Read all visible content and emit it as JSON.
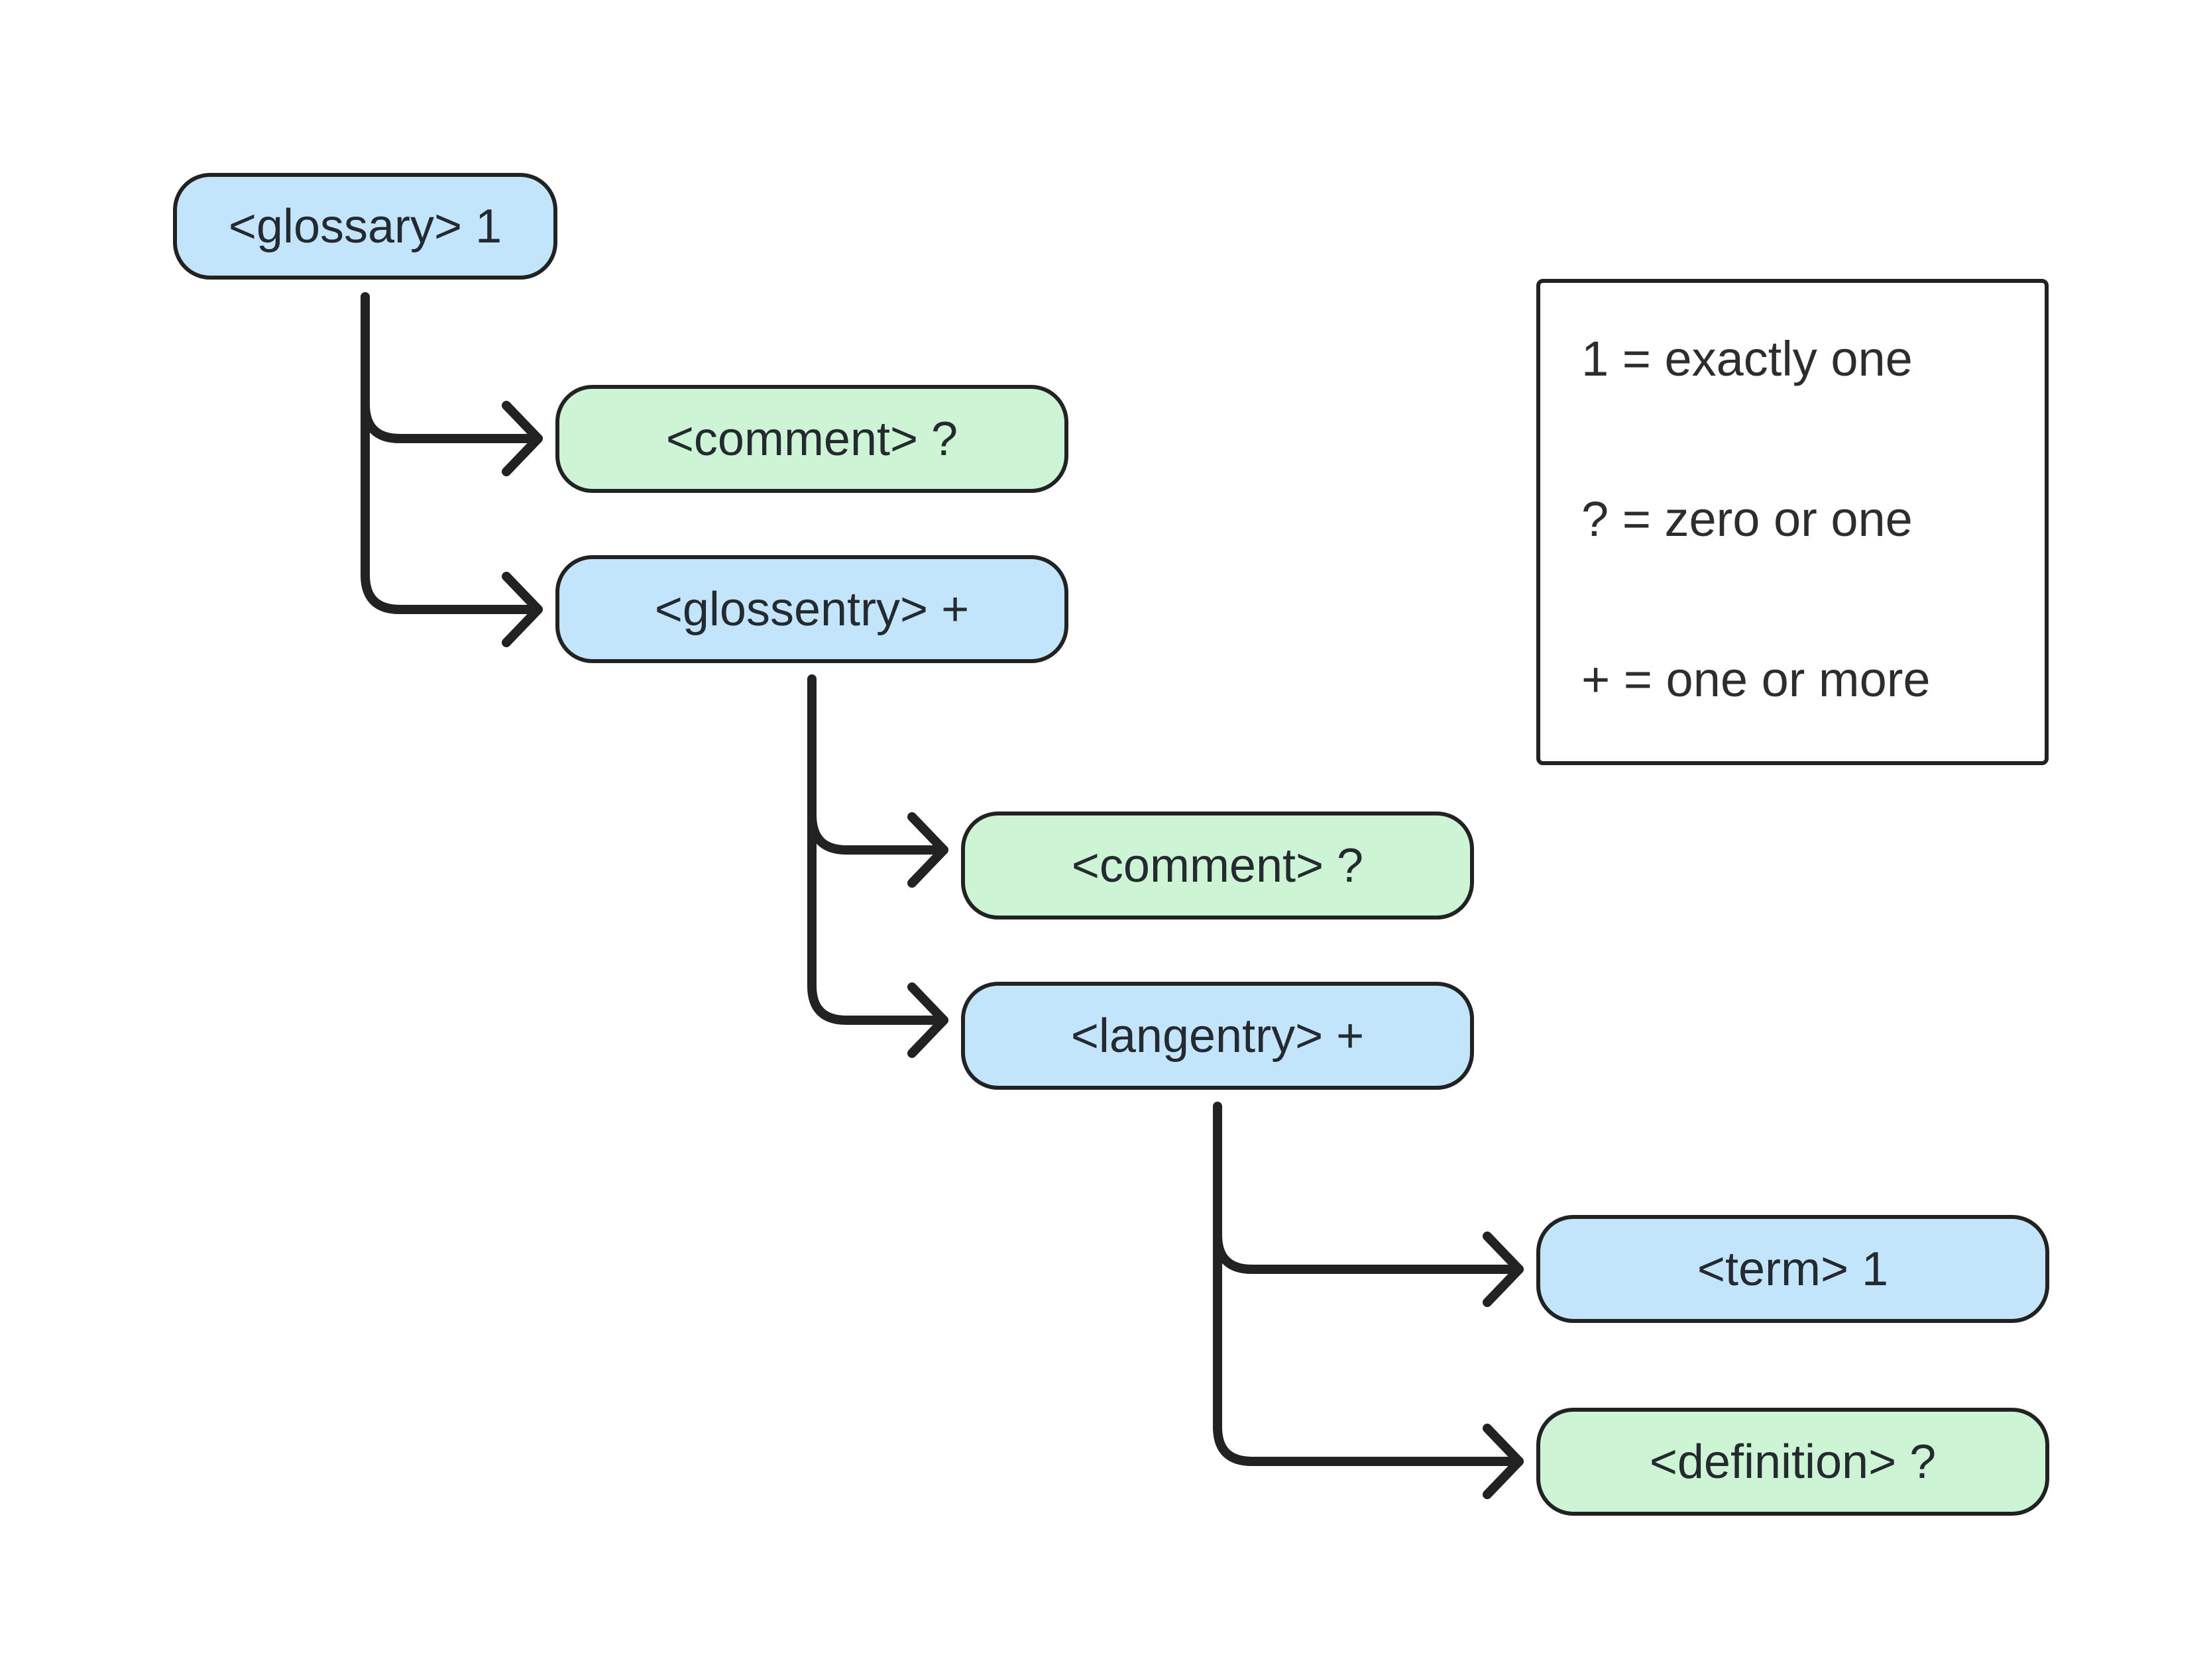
{
  "diagram": {
    "title": "",
    "nodes": [
      {
        "id": "glossary",
        "label": "<glossary> 1",
        "color": "#c3e5fc",
        "kind": "required"
      },
      {
        "id": "comment-1",
        "label": "<comment> ?",
        "color": "#cdf4d4",
        "kind": "optional"
      },
      {
        "id": "glossentry",
        "label": "<glossentry> +",
        "color": "#c3e5fc",
        "kind": "required"
      },
      {
        "id": "comment-2",
        "label": "<comment> ?",
        "color": "#cdf4d4",
        "kind": "optional"
      },
      {
        "id": "langentry",
        "label": "<langentry> +",
        "color": "#c3e5fc",
        "kind": "required"
      },
      {
        "id": "term",
        "label": "<term> 1",
        "color": "#c3e5fc",
        "kind": "required"
      },
      {
        "id": "definition",
        "label": "<definition> ?",
        "color": "#cdf4d4",
        "kind": "optional"
      }
    ],
    "edges": [
      {
        "from": "glossary",
        "to": "comment-1"
      },
      {
        "from": "glossary",
        "to": "glossentry"
      },
      {
        "from": "glossentry",
        "to": "comment-2"
      },
      {
        "from": "glossentry",
        "to": "langentry"
      },
      {
        "from": "langentry",
        "to": "term"
      },
      {
        "from": "langentry",
        "to": "definition"
      }
    ],
    "legend": {
      "items": [
        {
          "symbol": "1",
          "meaning": "exactly one",
          "text": "1 = exactly one"
        },
        {
          "symbol": "?",
          "meaning": "zero or one",
          "text": "? = zero or one"
        },
        {
          "symbol": "+",
          "meaning": "one or more",
          "text": "+ = one or more"
        }
      ]
    },
    "colors": {
      "required_fill": "#c3e5fc",
      "optional_fill": "#cdf4d4",
      "stroke": "#222222",
      "text": "#252a30"
    }
  }
}
